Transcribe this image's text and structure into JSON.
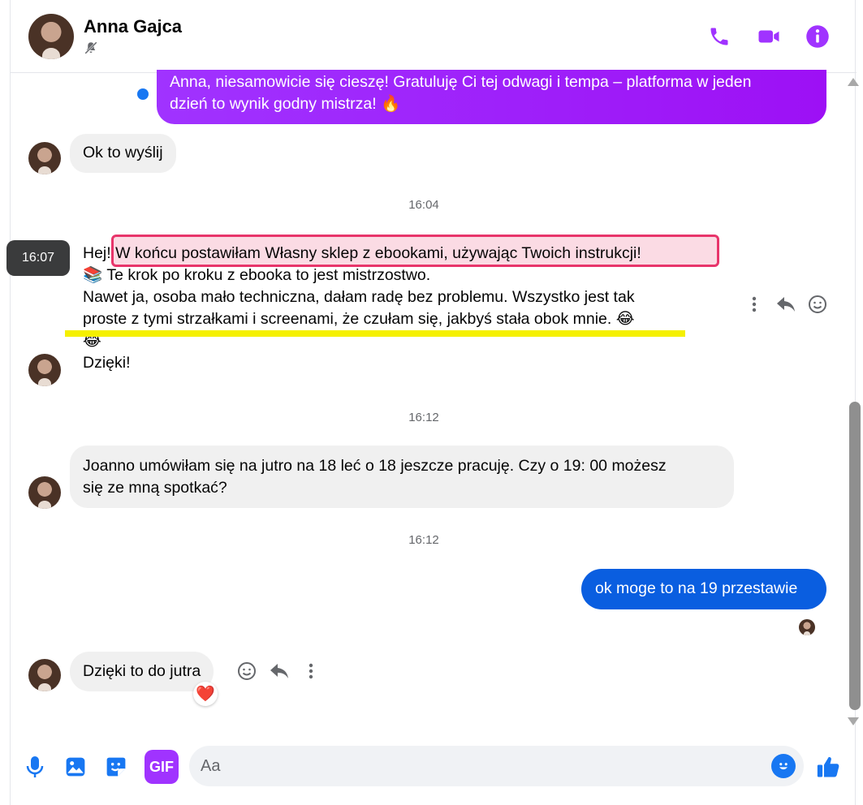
{
  "colors": {
    "accent_purple": "#a033ff",
    "blue": "#0a5ee0",
    "incoming_bg": "#f0f0f0"
  },
  "header": {
    "contact_name": "Anna Gajca",
    "icons": [
      "bell-slash-icon",
      "phone-icon",
      "video-icon",
      "info-icon"
    ]
  },
  "messages": {
    "m1": {
      "lines": [
        "Anna, niesamowicie się cieszę! Gratuluję Ci tej odwagi i tempa – platforma w jeden",
        "dzień to wynik godny mistrza! 🔥"
      ]
    },
    "m2": {
      "text": "Ok to wyślij"
    },
    "ts1": "16:04",
    "hover_time": "16:07",
    "m3": {
      "lines": [
        "Hej! W końcu postawiłam Własny sklep z ebookami, używając Twoich instrukcji!",
        "📚 Te krok po kroku z ebooka to jest mistrzostwo.",
        "Nawet ja, osoba mało techniczna, dałam radę bez problemu. Wszystko jest tak",
        "proste z tymi strzałkami i screenami, że czułam się, jakbyś stała obok mnie. 😂",
        "😂",
        "Dzięki!"
      ]
    },
    "ts2": "16:12",
    "m4": {
      "lines": [
        "Joanno umówiłam się na jutro na 18 leć o 18 jeszcze pracuję. Czy o 19: 00 możesz",
        "się ze mną spotkać?"
      ]
    },
    "ts3": "16:12",
    "m5": {
      "text": "ok moge to na 19 przestawie"
    },
    "m6": {
      "text": "Dzięki to do jutra",
      "reaction": "❤️"
    }
  },
  "composer": {
    "placeholder": "Aa",
    "gif_label": "GIF",
    "icons": [
      "microphone-icon",
      "image-icon",
      "sticker-icon",
      "gif-icon",
      "emoji-icon",
      "thumbs-up-icon"
    ]
  }
}
